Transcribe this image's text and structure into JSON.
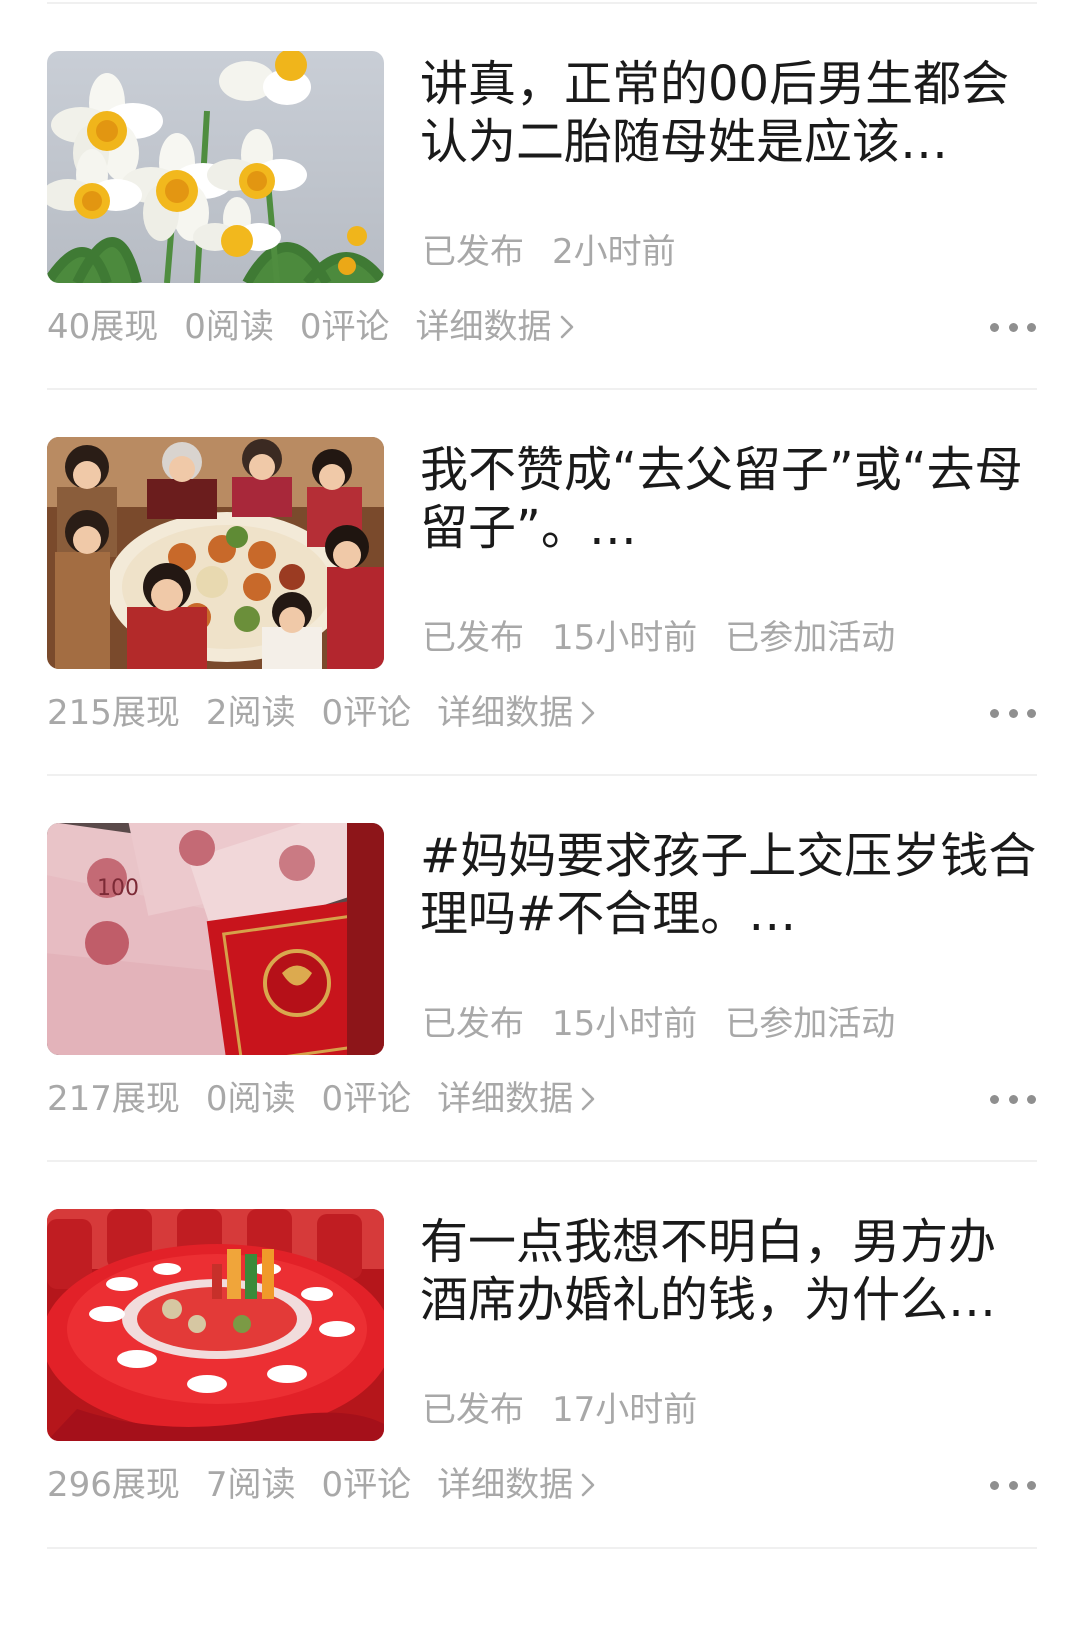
{
  "articles": [
    {
      "title": "讲真，正常的00后男生都会认为二胎随母姓是应该…",
      "status": "已发布",
      "time": "2小时前",
      "activity": "",
      "impressions": "40展现",
      "reads": "0阅读",
      "comments": "0评论",
      "details_label": "详细数据",
      "thumbnail_icon": "daffodil-flowers-image"
    },
    {
      "title": "我不赞成“去父留子”或“去母留子”。…",
      "status": "已发布",
      "time": "15小时前",
      "activity": "已参加活动",
      "impressions": "215展现",
      "reads": "2阅读",
      "comments": "0评论",
      "details_label": "详细数据",
      "thumbnail_icon": "family-dinner-image"
    },
    {
      "title": "#妈妈要求孩子上交压岁钱合理吗#不合理。…",
      "status": "已发布",
      "time": "15小时前",
      "activity": "已参加活动",
      "impressions": "217展现",
      "reads": "0阅读",
      "comments": "0评论",
      "details_label": "详细数据",
      "thumbnail_icon": "money-red-envelope-image"
    },
    {
      "title": "有一点我想不明白，男方办酒席办婚礼的钱，为什么…",
      "status": "已发布",
      "time": "17小时前",
      "activity": "",
      "impressions": "296展现",
      "reads": "7阅读",
      "comments": "0评论",
      "details_label": "详细数据",
      "thumbnail_icon": "banquet-table-image"
    }
  ],
  "colors": {
    "title": "#1a1a1a",
    "muted": "#a8a8a8",
    "divider": "#f0f0f0"
  }
}
